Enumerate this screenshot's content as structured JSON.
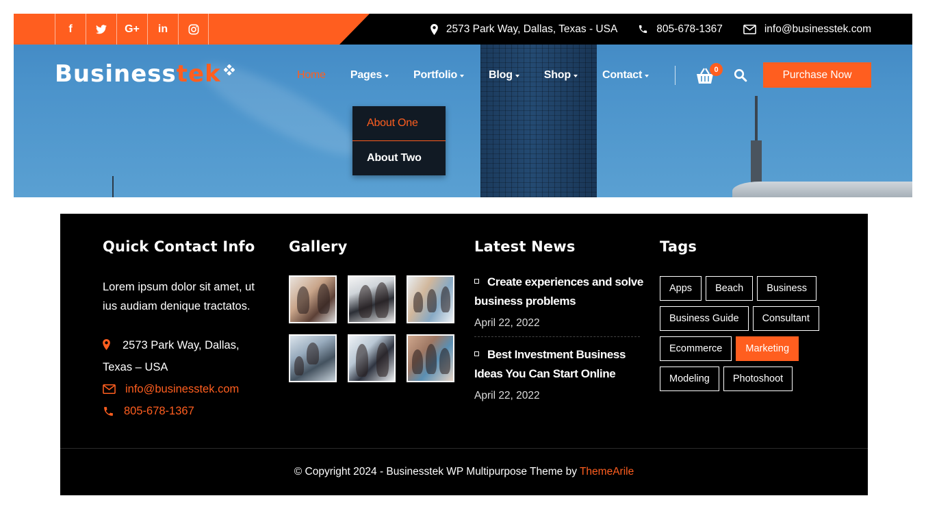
{
  "header": {
    "social": [
      {
        "label": "f",
        "icon": "facebook-icon"
      },
      {
        "label": "",
        "icon": "twitter-icon"
      },
      {
        "label": "G+",
        "icon": "google-plus-icon"
      },
      {
        "label": "in",
        "icon": "linkedin-icon"
      },
      {
        "label": "",
        "icon": "instagram-icon"
      }
    ],
    "contact": {
      "address": "2573 Park Way, Dallas, Texas - USA",
      "phone": "805-678-1367",
      "email": "info@businesstek.com"
    },
    "logo": {
      "part1": "Business",
      "part2": "tek"
    },
    "nav": [
      {
        "label": "Home",
        "active": true
      },
      {
        "label": "Pages"
      },
      {
        "label": "Portfolio"
      },
      {
        "label": "Blog"
      },
      {
        "label": "Shop"
      },
      {
        "label": "Contact"
      }
    ],
    "cart_count": "0",
    "purchase_label": "Purchase Now",
    "dropdown": [
      "About One",
      "About Two"
    ]
  },
  "footer": {
    "contact": {
      "title": "Quick Contact Info",
      "desc": "Lorem ipsum dolor sit amet, ut ius audiam denique tractatos.",
      "address": "2573 Park Way, Dallas, Texas – USA",
      "email": "info@businesstek.com",
      "phone": "805-678-1367"
    },
    "gallery": {
      "title": "Gallery"
    },
    "news": {
      "title": "Latest News",
      "items": [
        {
          "title": "Create experiences and solve business problems",
          "date": "April 22, 2022"
        },
        {
          "title": "Best Investment Business Ideas You Can Start Online",
          "date": "April 22, 2022"
        }
      ]
    },
    "tags": {
      "title": "Tags",
      "items": [
        "Apps",
        "Beach",
        "Business",
        "Business Guide",
        "Consultant",
        "Ecommerce",
        "Marketing",
        "Modeling",
        "Photoshoot"
      ],
      "active": "Marketing"
    },
    "copyright": "© Copyright 2024 - Businesstek WP Multipurpose Theme by",
    "copyright_brand": "ThemeArile"
  },
  "colors": {
    "accent": "#ff5e1f",
    "dark": "#000000"
  }
}
